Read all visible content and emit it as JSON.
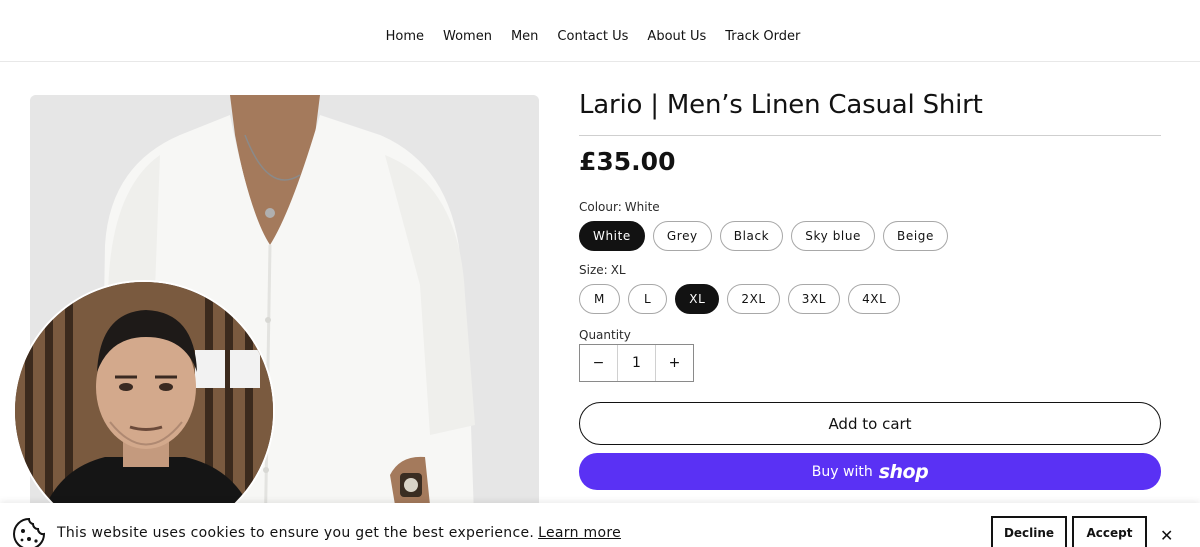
{
  "nav": {
    "items": [
      "Home",
      "Women",
      "Men",
      "Contact Us",
      "About Us",
      "Track Order"
    ]
  },
  "product": {
    "title": "Lario | Men’s Linen Casual Shirt",
    "price": "£35.00",
    "colour": {
      "label": "Colour:",
      "selected": "White",
      "options": [
        "White",
        "Grey",
        "Black",
        "Sky blue",
        "Beige"
      ]
    },
    "size": {
      "label": "Size:",
      "selected": "XL",
      "options": [
        "M",
        "L",
        "XL",
        "2XL",
        "3XL",
        "4XL"
      ]
    },
    "quantity": {
      "label": "Quantity",
      "value": "1",
      "minus": "−",
      "plus": "+"
    },
    "add_to_cart": "Add to cart",
    "buy_with": "Buy with",
    "shop_logo": "shop"
  },
  "cookie": {
    "text": "This website uses cookies to ensure you get the best experience.",
    "learn_more": "Learn more",
    "decline": "Decline",
    "accept": "Accept",
    "close": "✕"
  },
  "colors": {
    "shop_purple": "#5a31f4",
    "selected_pill": "#121212"
  }
}
